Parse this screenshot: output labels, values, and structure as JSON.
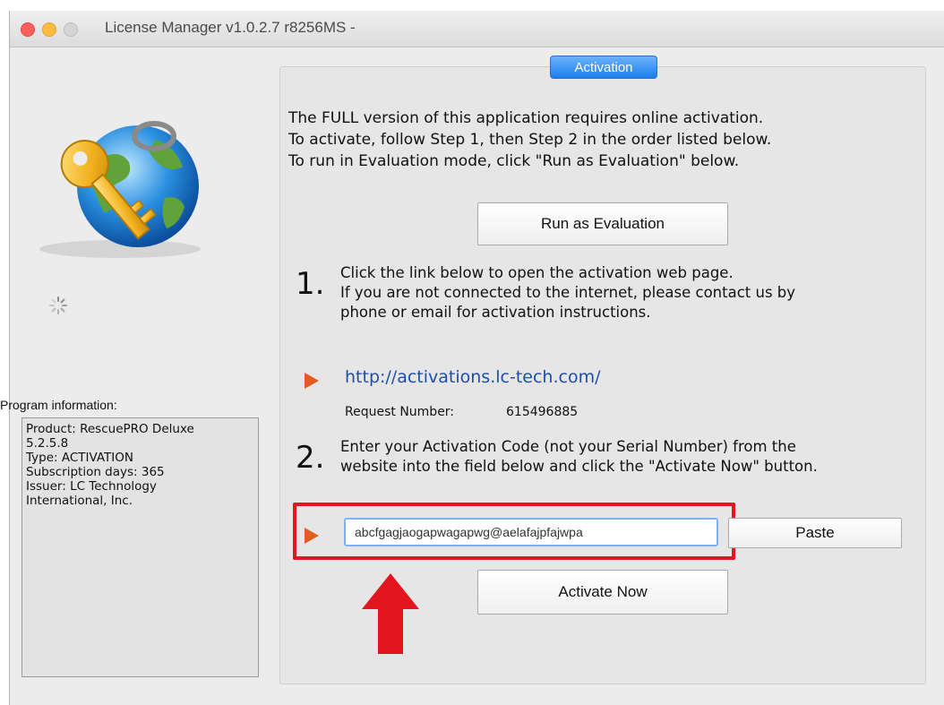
{
  "window": {
    "title": "License Manager v1.0.2.7 r8256MS -"
  },
  "sidebar": {
    "program_info_label": "Program information:",
    "program_info_text": "Product: RescuePRO Deluxe\n5.2.5.8\nType: ACTIVATION\nSubscription days: 365\nIssuer: LC Technology\nInternational, Inc.",
    "logo_icon": "key-globe-icon",
    "spinner_icon": "loading-spinner-icon"
  },
  "activation": {
    "tab_label": "Activation",
    "intro_lines": [
      "The FULL version of this application requires online activation.",
      "To activate, follow Step 1, then Step 2 in the order listed below.",
      "To run in Evaluation mode, click \"Run as Evaluation\" below."
    ],
    "run_eval_label": "Run as Evaluation",
    "step1": {
      "number": "1.",
      "lines": [
        "Click the link below to open the activation web page.",
        "If you are not connected to the internet, please contact us by",
        "phone or email for activation instructions."
      ]
    },
    "link_text": "http://activations.lc-tech.com/",
    "request_label": "Request Number:",
    "request_number": "615496885",
    "step2": {
      "number": "2.",
      "lines": [
        "Enter your Activation Code (not your Serial Number) from the",
        "website into the field below and click the \"Activate Now\" button."
      ]
    },
    "code_input_value": "abcfgagjaogapwagapwg@aelafajpfajwpa",
    "paste_label": "Paste",
    "activate_label": "Activate Now"
  },
  "colors": {
    "accent_arrow": "#e35b1e",
    "highlight": "#e3151f",
    "link": "#1e4fa8",
    "tab": "#1d7ef0"
  }
}
